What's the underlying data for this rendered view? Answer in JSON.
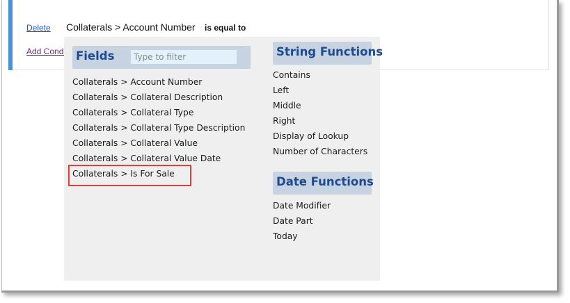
{
  "condition": {
    "delete_label": "Delete",
    "add_condition_label": "Add Condition",
    "field": "Collaterals > Account Number",
    "operator": "is equal to"
  },
  "dropdown": {
    "fields": {
      "title": "Fields",
      "filter_placeholder": "Type to filter",
      "items": [
        "Collaterals > Account Number",
        "Collaterals > Collateral Description",
        "Collaterals > Collateral Type",
        "Collaterals > Collateral Type Description",
        "Collaterals > Collateral Value",
        "Collaterals > Collateral Value Date",
        "Collaterals > Is For Sale"
      ],
      "highlighted_item": "Collaterals > Is For Sale"
    },
    "string_functions": {
      "title": "String Functions",
      "items": [
        "Contains",
        "Left",
        "Middle",
        "Right",
        "Display of Lookup",
        "Number of Characters"
      ]
    },
    "date_functions": {
      "title": "Date Functions",
      "items": [
        "Date Modifier",
        "Date Part",
        "Today"
      ]
    }
  },
  "colors": {
    "accent_bar": "#4a90d9",
    "section_header_bg": "#c7d3e1",
    "section_title": "#1f4a8f",
    "highlight_box": "#e0403a",
    "link": "#1a56c8",
    "visited_link": "#7a1f7a"
  }
}
